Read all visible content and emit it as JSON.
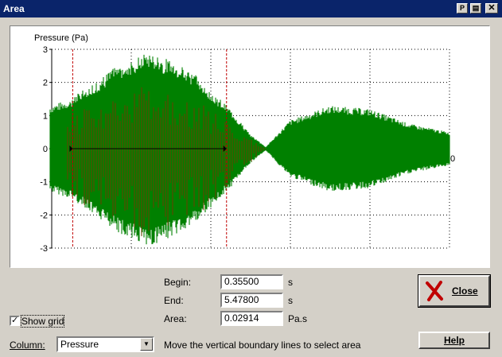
{
  "window": {
    "title": "Area"
  },
  "titlebar_buttons": [
    {
      "name": "pin-button",
      "glyph": "P"
    },
    {
      "name": "export-button",
      "glyph": "▤"
    },
    {
      "name": "close-window-button",
      "glyph": "✕"
    }
  ],
  "chart_data": {
    "type": "line",
    "ylabel": "Pressure (Pa)",
    "yticks": [
      "3",
      "2",
      "1",
      "0",
      "-1",
      "-2",
      "-3"
    ],
    "ylim": [
      -3,
      3
    ],
    "zero_label": "0",
    "grid": true,
    "series": [
      {
        "color": "#008000",
        "style": "waveform envelope",
        "envelope_points": [
          [
            0.0,
            1.3
          ],
          [
            0.05,
            1.5
          ],
          [
            0.18,
            2.6
          ],
          [
            0.25,
            2.95
          ],
          [
            0.35,
            2.4
          ],
          [
            0.45,
            1.2
          ],
          [
            0.5,
            0.45
          ],
          [
            0.54,
            0.05
          ],
          [
            0.6,
            0.85
          ],
          [
            0.7,
            1.3
          ],
          [
            0.8,
            1.2
          ],
          [
            0.9,
            0.75
          ],
          [
            1.0,
            0.5
          ]
        ]
      },
      {
        "color": "#a02000",
        "style": "selected-area fill"
      }
    ],
    "boundaries": {
      "begin_s": 0.355,
      "end_s": 5.478,
      "color": "#c00000"
    }
  },
  "fields": {
    "begin_label": "Begin:",
    "begin_value": "0.35500",
    "begin_unit": "s",
    "end_label": "End:",
    "end_value": "5.47800",
    "end_unit": "s",
    "area_label": "Area:",
    "area_value": "0.02914",
    "area_unit": "Pa.s"
  },
  "buttons": {
    "close": "Close",
    "help": "Help"
  },
  "show_grid": {
    "label": "Show grid",
    "checked": true,
    "mark": "✓"
  },
  "column": {
    "label": "Column:",
    "value": "Pressure"
  },
  "hint": "Move the vertical boundary lines to select area",
  "colors": {
    "titlebar": "#0a246a",
    "face": "#d4d0c8",
    "wave": "#008000",
    "area": "#a02000",
    "boundary": "#c00000",
    "close_x": "#c00000"
  }
}
